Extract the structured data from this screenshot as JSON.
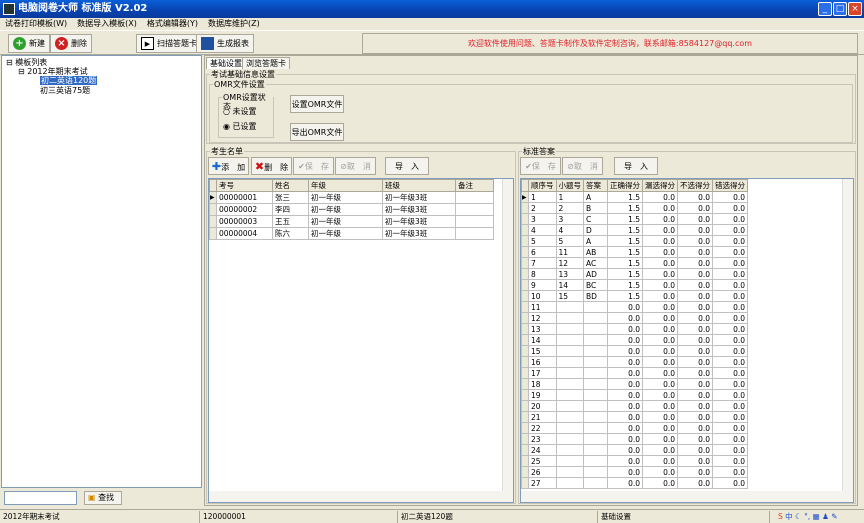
{
  "window": {
    "title": "电脑阅卷大师 标准版 V2.02"
  },
  "menu": [
    "试卷打印模板(W)",
    "数据导入模板(X)",
    "格式编辑器(Y)",
    "数据库维护(Z)"
  ],
  "toolbar": {
    "new": "新建",
    "delete": "删除",
    "scan": "扫描答题卡",
    "report": "生成报表",
    "notice": "欢迎软件使用问题、答题卡制作及软件定制咨询，联系邮箱:8584127@qq.com"
  },
  "tree": {
    "root": "模板列表",
    "exam": "2012年期末考试",
    "items": [
      "初二英语120题",
      "初三英语75题"
    ]
  },
  "search": {
    "value": "",
    "button": "查找"
  },
  "tabs": [
    "基础设置",
    "浏览答题卡"
  ],
  "basic": {
    "group": "考试基础信息设置",
    "omr_group": "OMR文件设置",
    "status_group": "OMR设置状态",
    "radio_unset": "未设置",
    "radio_set": "已设置",
    "set_omr": "设置OMR文件",
    "export_omr": "导出OMR文件"
  },
  "students": {
    "group": "考生名单",
    "add": "添　加",
    "delete": "删　除",
    "save": "保　存",
    "cancel": "取　消",
    "import": "导　入",
    "columns": [
      "考号",
      "姓名",
      "年级",
      "班级",
      "备注"
    ],
    "rows": [
      [
        "00000001",
        "张三",
        "初一年级",
        "初一年级3班",
        ""
      ],
      [
        "00000002",
        "李四",
        "初一年级",
        "初一年级3班",
        ""
      ],
      [
        "00000003",
        "王五",
        "初一年级",
        "初一年级3班",
        ""
      ],
      [
        "00000004",
        "陈六",
        "初一年级",
        "初一年级3班",
        ""
      ]
    ]
  },
  "answers": {
    "group": "标准答案",
    "save": "保　存",
    "cancel": "取　消",
    "import": "导　入",
    "columns": [
      "顺序号",
      "小题号",
      "答案",
      "正确得分",
      "漏选得分",
      "不选得分",
      "错选得分"
    ],
    "rows": [
      [
        "1",
        "1",
        "A",
        "1.5",
        "0.0",
        "0.0",
        "0.0"
      ],
      [
        "2",
        "2",
        "B",
        "1.5",
        "0.0",
        "0.0",
        "0.0"
      ],
      [
        "3",
        "3",
        "C",
        "1.5",
        "0.0",
        "0.0",
        "0.0"
      ],
      [
        "4",
        "4",
        "D",
        "1.5",
        "0.0",
        "0.0",
        "0.0"
      ],
      [
        "5",
        "5",
        "A",
        "1.5",
        "0.0",
        "0.0",
        "0.0"
      ],
      [
        "6",
        "11",
        "AB",
        "1.5",
        "0.0",
        "0.0",
        "0.0"
      ],
      [
        "7",
        "12",
        "AC",
        "1.5",
        "0.0",
        "0.0",
        "0.0"
      ],
      [
        "8",
        "13",
        "AD",
        "1.5",
        "0.0",
        "0.0",
        "0.0"
      ],
      [
        "9",
        "14",
        "BC",
        "1.5",
        "0.0",
        "0.0",
        "0.0"
      ],
      [
        "10",
        "15",
        "BD",
        "1.5",
        "0.0",
        "0.0",
        "0.0"
      ],
      [
        "11",
        "",
        "",
        "0.0",
        "0.0",
        "0.0",
        "0.0"
      ],
      [
        "12",
        "",
        "",
        "0.0",
        "0.0",
        "0.0",
        "0.0"
      ],
      [
        "13",
        "",
        "",
        "0.0",
        "0.0",
        "0.0",
        "0.0"
      ],
      [
        "14",
        "",
        "",
        "0.0",
        "0.0",
        "0.0",
        "0.0"
      ],
      [
        "15",
        "",
        "",
        "0.0",
        "0.0",
        "0.0",
        "0.0"
      ],
      [
        "16",
        "",
        "",
        "0.0",
        "0.0",
        "0.0",
        "0.0"
      ],
      [
        "17",
        "",
        "",
        "0.0",
        "0.0",
        "0.0",
        "0.0"
      ],
      [
        "18",
        "",
        "",
        "0.0",
        "0.0",
        "0.0",
        "0.0"
      ],
      [
        "19",
        "",
        "",
        "0.0",
        "0.0",
        "0.0",
        "0.0"
      ],
      [
        "20",
        "",
        "",
        "0.0",
        "0.0",
        "0.0",
        "0.0"
      ],
      [
        "21",
        "",
        "",
        "0.0",
        "0.0",
        "0.0",
        "0.0"
      ],
      [
        "22",
        "",
        "",
        "0.0",
        "0.0",
        "0.0",
        "0.0"
      ],
      [
        "23",
        "",
        "",
        "0.0",
        "0.0",
        "0.0",
        "0.0"
      ],
      [
        "24",
        "",
        "",
        "0.0",
        "0.0",
        "0.0",
        "0.0"
      ],
      [
        "25",
        "",
        "",
        "0.0",
        "0.0",
        "0.0",
        "0.0"
      ],
      [
        "26",
        "",
        "",
        "0.0",
        "0.0",
        "0.0",
        "0.0"
      ],
      [
        "27",
        "",
        "",
        "0.0",
        "0.0",
        "0.0",
        "0.0"
      ]
    ]
  },
  "statusbar": [
    "2012年期末考试",
    "120000001",
    "初二英语120题",
    "基础设置"
  ],
  "tray": [
    "中"
  ]
}
